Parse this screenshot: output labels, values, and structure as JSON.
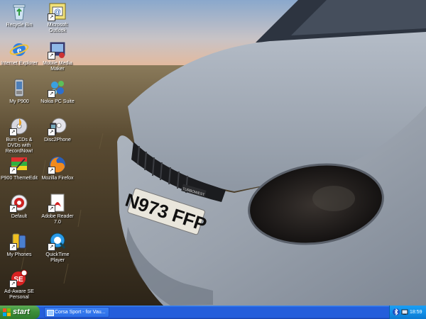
{
  "desktop": {
    "icons": [
      {
        "label": "Recycle Bin",
        "icon": "recycle-bin-icon"
      },
      {
        "label": "Microsoft Outlook",
        "icon": "outlook-icon"
      },
      {
        "label": "Internet Explorer",
        "icon": "internet-explorer-icon"
      },
      {
        "label": "Mobile Media Maker",
        "icon": "media-maker-icon"
      },
      {
        "label": "My P900",
        "icon": "phone-icon"
      },
      {
        "label": "Nokia PC Suite",
        "icon": "nokia-suite-icon"
      },
      {
        "label": "Burn CDs & DVDs with RecordNow!",
        "icon": "burn-cd-icon"
      },
      {
        "label": "Disc2Phone",
        "icon": "disc2phone-icon"
      },
      {
        "label": "P900 ThemeEdit",
        "icon": "theme-edit-icon"
      },
      {
        "label": "Mozilla Firefox",
        "icon": "firefox-icon"
      },
      {
        "label": "Default",
        "icon": "default-icon"
      },
      {
        "label": "Adobe Reader 7.0",
        "icon": "adobe-reader-icon"
      },
      {
        "label": "My Phones",
        "icon": "phones-icon"
      },
      {
        "label": "QuickTime Player",
        "icon": "quicktime-icon"
      },
      {
        "label": "Ad-Aware SE Personal",
        "icon": "ad-aware-icon"
      }
    ]
  },
  "wallpaper": {
    "plate_text": "N973 FFP",
    "badge_text": "TURBOWEST"
  },
  "taskbar": {
    "start_label": "start",
    "task_label": "Corsa Sport - for Vau...",
    "clock": "18:59"
  },
  "colors": {
    "taskbar_blue": "#245edb",
    "start_green": "#3c8f3a",
    "tray_blue": "#1290e8"
  }
}
